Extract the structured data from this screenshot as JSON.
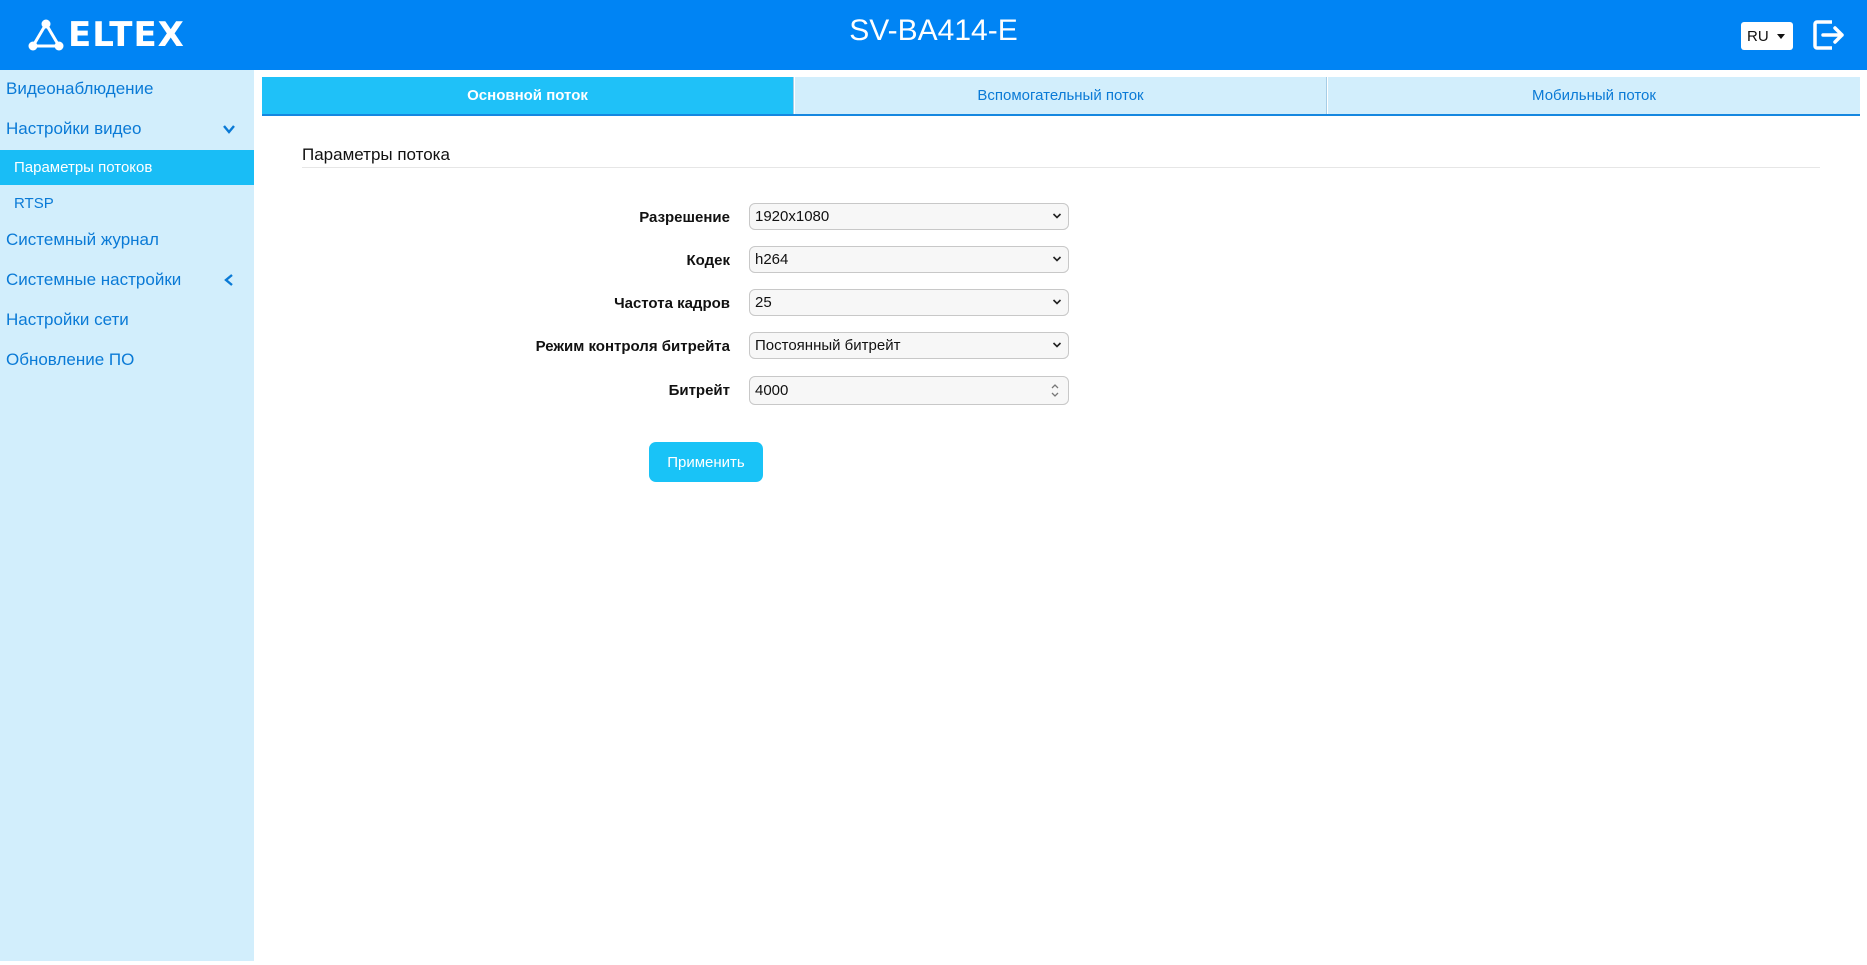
{
  "header": {
    "logo_text": "ELTEX",
    "device_title": "SV-BA414-E",
    "language": "RU",
    "logout_icon": "logout-icon"
  },
  "sidebar": {
    "items": [
      {
        "label": "Видеонаблюдение"
      },
      {
        "label": "Настройки видео",
        "expanded": true,
        "icon": "chevron-down-icon"
      },
      {
        "label": "Параметры потоков",
        "active": true
      },
      {
        "label": "RTSP"
      },
      {
        "label": "Системный журнал"
      },
      {
        "label": "Системные настройки",
        "expanded": false,
        "icon": "chevron-left-icon"
      },
      {
        "label": "Настройки сети"
      },
      {
        "label": "Обновление ПО"
      }
    ]
  },
  "tabs": [
    {
      "label": "Основной поток",
      "active": true
    },
    {
      "label": "Вспомогательный поток"
    },
    {
      "label": "Мобильный поток"
    }
  ],
  "section": {
    "title": "Параметры потока"
  },
  "form": {
    "resolution": {
      "label": "Разрешение",
      "value": "1920x1080"
    },
    "codec": {
      "label": "Кодек",
      "value": "h264"
    },
    "framerate": {
      "label": "Частота кадров",
      "value": "25"
    },
    "bitrate_mode": {
      "label": "Режим контроля битрейта",
      "value": "Постоянный битрейт"
    },
    "bitrate": {
      "label": "Битрейт",
      "value": "4000"
    }
  },
  "apply_label": "Применить",
  "colors": {
    "header_bg": "#0084f4",
    "sidebar_bg": "#d2eefc",
    "active_accent": "#19bdf6",
    "link_text": "#0a7ad6"
  }
}
